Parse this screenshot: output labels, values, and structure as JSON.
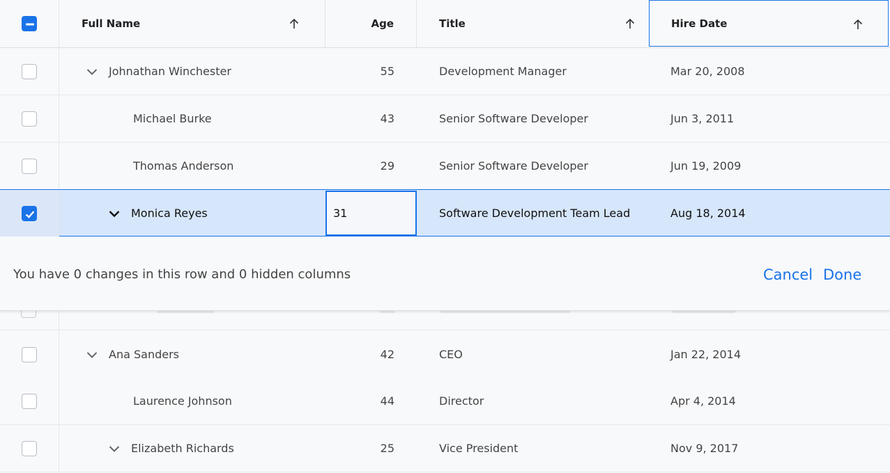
{
  "columns": {
    "full_name": "Full Name",
    "age": "Age",
    "title": "Title",
    "hire_date": "Hire Date"
  },
  "rows": [
    {
      "name": "Johnathan Winchester",
      "age": "55",
      "title": "Development Manager",
      "hire": "Mar 20, 2008",
      "expanded": true,
      "level": 0,
      "checked": false
    },
    {
      "name": "Michael Burke",
      "age": "43",
      "title": "Senior Software Developer",
      "hire": "Jun 3, 2011",
      "level": 1,
      "checked": false
    },
    {
      "name": "Thomas Anderson",
      "age": "29",
      "title": "Senior Software Developer",
      "hire": "Jun 19, 2009",
      "level": 1,
      "checked": false
    },
    {
      "name": "Monica Reyes",
      "age": "31",
      "title": "Software Development Team Lead",
      "hire": "Aug 18, 2014",
      "expanded": true,
      "level": 1,
      "checked": true,
      "editing": true
    },
    {
      "name": "Ana Sanders",
      "age": "42",
      "title": "CEO",
      "hire": "Jan 22, 2014",
      "expanded": true,
      "level": 0,
      "checked": false
    },
    {
      "name": "Laurence Johnson",
      "age": "44",
      "title": "Director",
      "hire": "Apr 4, 2014",
      "level": 1,
      "checked": false
    },
    {
      "name": "Elizabeth Richards",
      "age": "25",
      "title": "Vice President",
      "hire": "Nov 9, 2017",
      "expanded": true,
      "level": 1,
      "checked": false
    }
  ],
  "edit_bar": {
    "message": "You have 0 changes in this row and 0 hidden columns",
    "cancel": "Cancel",
    "done": "Done"
  },
  "colors": {
    "accent": "#1a73e8",
    "selected_row": "#d6e6fb"
  },
  "icons": {
    "sort": "arrow-up-icon",
    "expand": "chevron-down-icon",
    "select_all": "indeterminate-checkbox-icon"
  }
}
